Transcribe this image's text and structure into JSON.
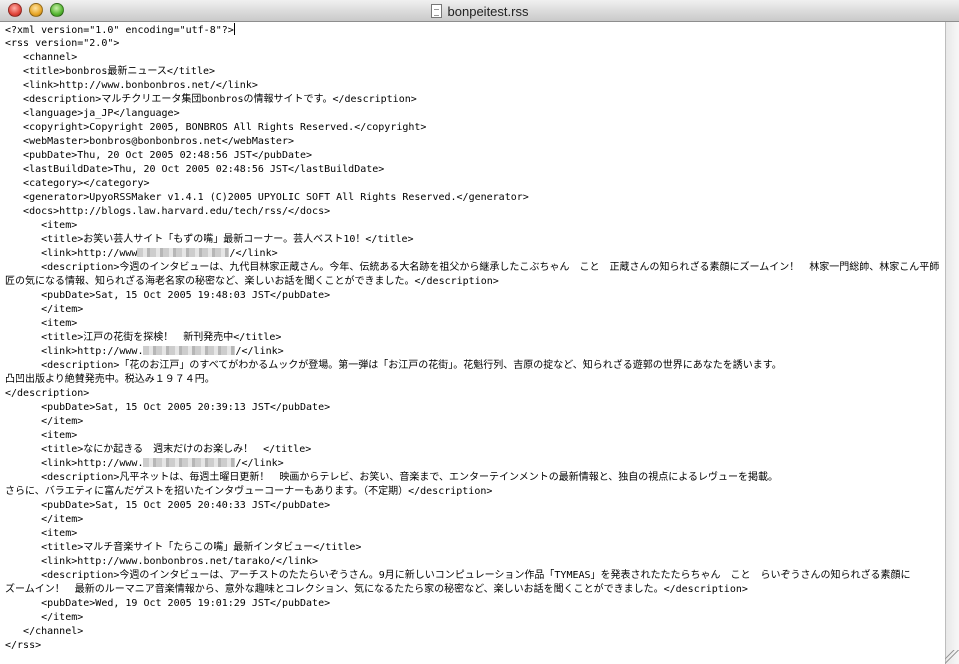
{
  "window": {
    "title": "bonpeitest.rss",
    "icon": "document-icon",
    "controls": [
      "close-icon",
      "minimize-icon",
      "zoom-icon"
    ]
  },
  "document": {
    "lines": [
      {
        "pre": "<?xml version=\"1.0\" encoding=\"utf-8\"?>",
        "cursor": true
      },
      {
        "pre": "<rss version=\"2.0\">"
      },
      {
        "pre": "   <channel>"
      },
      {
        "pre": "   <title>bonbros最新ニュース</title>"
      },
      {
        "pre": "   <link>http://www.bonbonbros.net/</link>"
      },
      {
        "pre": "   <description>マルチクリエータ集団bonbrosの情報サイトです。</description>"
      },
      {
        "pre": "   <language>ja_JP</language>"
      },
      {
        "pre": "   <copyright>Copyright 2005, BONBROS All Rights Reserved.</copyright>"
      },
      {
        "pre": "   <webMaster>bonbros@bonbonbros.net</webMaster>"
      },
      {
        "pre": "   <pubDate>Thu, 20 Oct 2005 02:48:56 JST</pubDate>"
      },
      {
        "pre": "   <lastBuildDate>Thu, 20 Oct 2005 02:48:56 JST</lastBuildDate>"
      },
      {
        "pre": "   <category></category>"
      },
      {
        "pre": "   <generator>UpyoRSSMaker v1.4.1 (C)2005 UPYOLIC SOFT All Rights Reserved.</generator>"
      },
      {
        "pre": "   <docs>http://blogs.law.harvard.edu/tech/rss/</docs>"
      },
      {
        "pre": "      <item>"
      },
      {
        "pre": "      <title>お笑い芸人サイト「もずの嘴」最新コーナー。芸人ベスト10！</title>"
      },
      {
        "pre": "      <link>http://www",
        "redacted": true,
        "post": "/</link>"
      },
      {
        "pre": "      <description>今週のインタビューは、九代目林家正蔵さん。今年、伝統ある大名跡を祖父から継承したこぶちゃん　こと　正蔵さんの知られざる素顔にズームイン！　林家一門総帥、林家こん平師"
      },
      {
        "pre": "匠の気になる情報、知られざる海老名家の秘密など、楽しいお話を聞くことができました。</description>"
      },
      {
        "pre": "      <pubDate>Sat, 15 Oct 2005 19:48:03 JST</pubDate>"
      },
      {
        "pre": "      </item>"
      },
      {
        "pre": "      <item>"
      },
      {
        "pre": "      <title>江戸の花街を探検！　新刊発売中</title>"
      },
      {
        "pre": "      <link>http://www.",
        "redacted": true,
        "post": "/</link>"
      },
      {
        "pre": "      <description>「花のお江戸」のすべてがわかるムックが登場。第一弾は「お江戸の花街」。花魁行列、吉原の掟など、知られざる遊郭の世界にあなたを誘います。"
      },
      {
        "pre": "凸凹出版より絶賛発売中。税込み１９７４円。"
      },
      {
        "pre": "</description>"
      },
      {
        "pre": "      <pubDate>Sat, 15 Oct 2005 20:39:13 JST</pubDate>"
      },
      {
        "pre": "      </item>"
      },
      {
        "pre": "      <item>"
      },
      {
        "pre": "      <title>なにか起きる　週末だけのお楽しみ！　</title>"
      },
      {
        "pre": "      <link>http://www.",
        "redacted": true,
        "post": "/</link>"
      },
      {
        "pre": "      <description>凡平ネットは、毎週土曜日更新！　映画からテレビ、お笑い、音楽まで、エンターテインメントの最新情報と、独自の視点によるレヴューを掲載。"
      },
      {
        "pre": "さらに、バラエティに富んだゲストを招いたインタヴューコーナーもあります。（不定期）</description>"
      },
      {
        "pre": "      <pubDate>Sat, 15 Oct 2005 20:40:33 JST</pubDate>"
      },
      {
        "pre": "      </item>"
      },
      {
        "pre": "      <item>"
      },
      {
        "pre": "      <title>マルチ音楽サイト「たらこの嘴」最新インタビュー</title>"
      },
      {
        "pre": "      <link>http://www.bonbonbros.net/tarako/</link>"
      },
      {
        "pre": "      <description>今週のインタビューは、アーチストのたたらいぞうさん。9月に新しいコンピュレーション作品「TYMEAS」を発表されたたたらちゃん　こと　らいぞうさんの知られざる素顔に"
      },
      {
        "pre": "ズームイン！　最新のルーマニア音楽情報から、意外な趣味とコレクション、気になるたたら家の秘密など、楽しいお話を聞くことができました。</description>"
      },
      {
        "pre": "      <pubDate>Wed, 19 Oct 2005 19:01:29 JST</pubDate>"
      },
      {
        "pre": "      </item>"
      },
      {
        "pre": "   </channel>"
      },
      {
        "pre": "</rss>"
      }
    ]
  }
}
